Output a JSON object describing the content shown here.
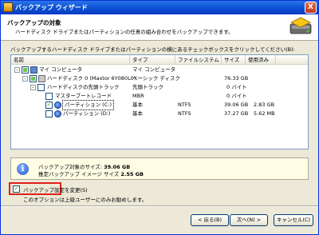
{
  "window": {
    "title": "バックアップ ウィザード",
    "close_label": "X"
  },
  "header": {
    "title": "バックアップの対象",
    "subtitle": "ハードディスク ドライブまたはパーティションの任意の組み合わせをバックアップできます。"
  },
  "instruction": "バックアップするハードディスク ドライブまたはパーティションの横にあるチェックボックスをクリックしてください(B):",
  "grid": {
    "columns": [
      "名前",
      "タイプ",
      "ファイルシステム",
      "サイズ",
      "使用済み"
    ],
    "rows": [
      {
        "expander": "-",
        "checkbox": "partial",
        "icon": "computer-icon",
        "name": "マイ コンピュータ",
        "type": "マイ コンピュータ",
        "fs": "",
        "size": "",
        "used": ""
      },
      {
        "expander": "-",
        "checkbox": "partial",
        "icon": "disk-icon",
        "name": "ハードディスク 0 (Maxtor 6Y080L0)",
        "type": "ベーシック ディスク",
        "fs": "",
        "size": "76.33 GB",
        "used": ""
      },
      {
        "expander": "-",
        "checkbox": "empty",
        "icon": "disk-icon",
        "name": "ハードディスクの先頭トラック",
        "type": "先頭トラック",
        "fs": "",
        "size": "0 バイト",
        "used": ""
      },
      {
        "expander": "",
        "checkbox": "empty",
        "icon": "",
        "name": "マスターブートレコード",
        "type": "MBR",
        "fs": "",
        "size": "0 バイト",
        "used": ""
      },
      {
        "expander": "",
        "checkbox": "checked",
        "icon": "partition-icon",
        "name": "パーティション (C:)",
        "type": "基本",
        "fs": "NTFS",
        "size": "39.06 GB",
        "used": "2.83 GB"
      },
      {
        "expander": "",
        "checkbox": "empty",
        "icon": "partition-icon",
        "name": "パーティション (D:)",
        "type": "基本",
        "fs": "NTFS",
        "size": "37.27 GB",
        "used": "5.62 MB"
      }
    ]
  },
  "info": {
    "line1_label": "バックアップ対象のサイズ: ",
    "line1_value": "39.06 GB",
    "line2_label": "推定バックアップ イメージ サイズ ",
    "line2_value": "2.55 GB"
  },
  "option": {
    "label": "バックアップ設定を変更(S)",
    "checked": "✓",
    "note": "このオプションは上級ユーザーにのみお勧めします。"
  },
  "buttons": {
    "back": "< 戻る(B)",
    "next": "次へ(N) >",
    "cancel": "キャンセル(C)"
  }
}
